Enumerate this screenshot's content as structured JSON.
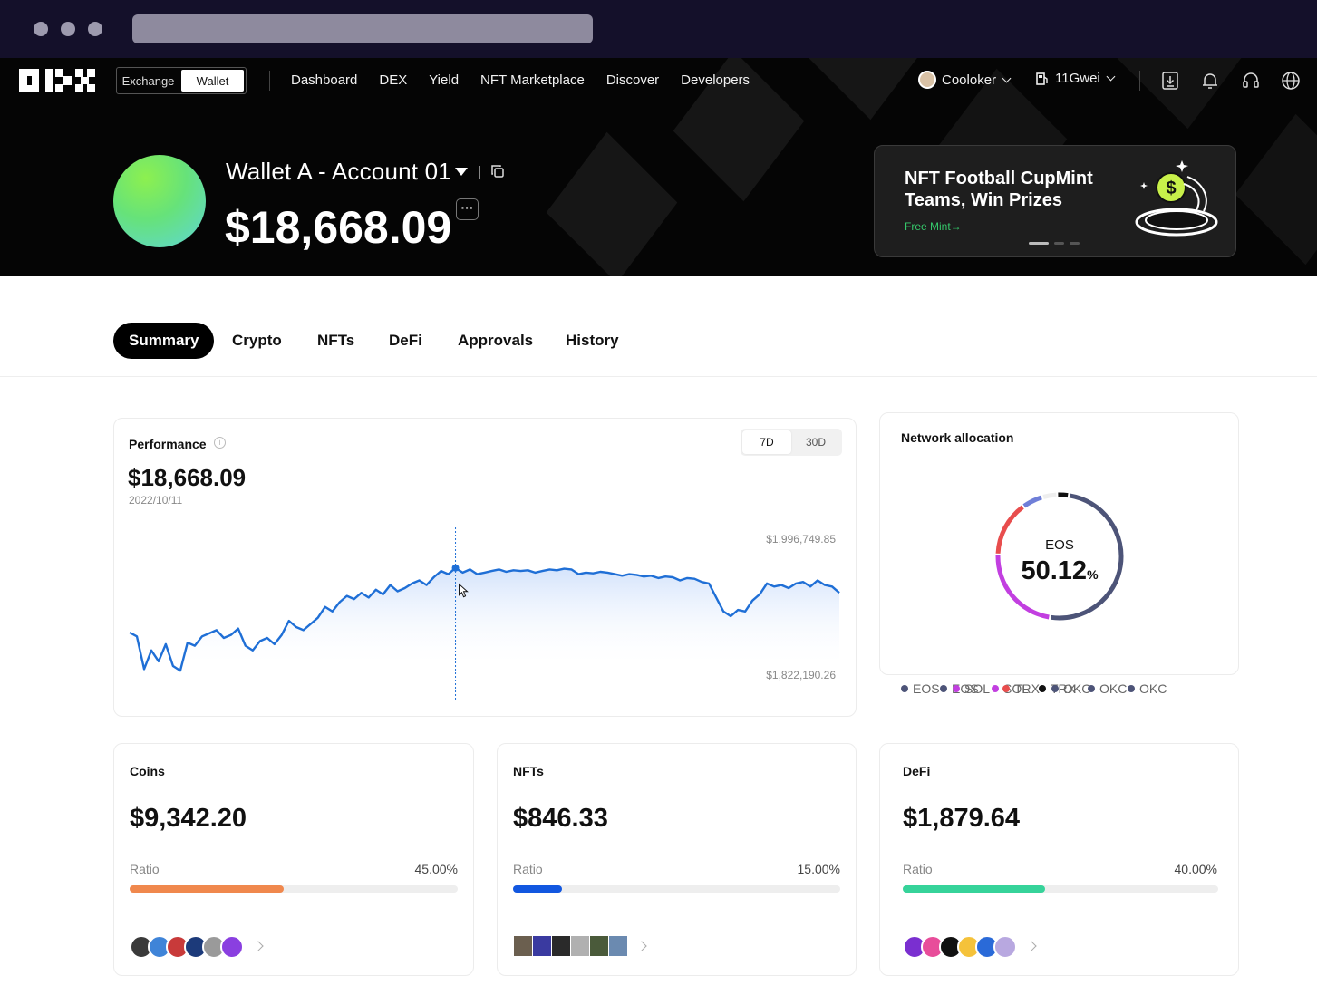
{
  "header": {
    "mode_tabs": [
      "Exchange",
      "Wallet"
    ],
    "active_mode": "Wallet",
    "nav": [
      "Dashboard",
      "DEX",
      "Yield",
      "NFT Marketplace",
      "Discover",
      "Developers"
    ],
    "username": "Cooloker",
    "gas": "11Gwei",
    "icons": [
      "download-icon",
      "bell-icon",
      "headset-icon",
      "globe-icon"
    ]
  },
  "wallet": {
    "name": "Wallet A - Account 01",
    "balance": "$18,668.09",
    "more_label": "···"
  },
  "promo": {
    "title": "NFT Football CupMint Teams, Win Prizes",
    "link": "Free Mint→",
    "slides": 3,
    "active_slide": 1
  },
  "tabs": [
    "Summary",
    "Crypto",
    "NFTs",
    "DeFi",
    "Approvals",
    "History"
  ],
  "active_tab": "Summary",
  "performance": {
    "title": "Performance",
    "value": "$18,668.09",
    "date": "2022/10/11",
    "ranges": [
      "7D",
      "30D"
    ],
    "active_range": "7D",
    "max_label": "$1,996,749.85",
    "min_label": "$1,822,190.26"
  },
  "chart_data": {
    "type": "area",
    "title": "Performance",
    "ylim": [
      1822190.26,
      1996749.85
    ],
    "color": "#1f6fd6",
    "selected_index": 45,
    "values": [
      1885000,
      1880000,
      1838000,
      1862000,
      1848000,
      1870000,
      1842000,
      1836000,
      1872000,
      1868000,
      1880000,
      1884000,
      1888000,
      1878000,
      1882000,
      1890000,
      1868000,
      1862000,
      1874000,
      1878000,
      1870000,
      1882000,
      1900000,
      1892000,
      1888000,
      1896000,
      1904000,
      1918000,
      1912000,
      1924000,
      1932000,
      1928000,
      1936000,
      1930000,
      1940000,
      1934000,
      1946000,
      1938000,
      1942000,
      1948000,
      1952000,
      1946000,
      1956000,
      1964000,
      1960000,
      1968000,
      1962000,
      1966000,
      1960000,
      1962000,
      1964000,
      1966000,
      1963000,
      1965000,
      1964000,
      1965000,
      1962000,
      1964000,
      1966000,
      1965000,
      1967000,
      1966000,
      1960000,
      1962000,
      1961000,
      1963000,
      1962000,
      1960000,
      1958000,
      1960000,
      1959000,
      1957000,
      1958000,
      1955000,
      1957000,
      1956000,
      1952000,
      1955000,
      1954000,
      1950000,
      1948000,
      1930000,
      1912000,
      1906000,
      1914000,
      1912000,
      1926000,
      1934000,
      1948000,
      1944000,
      1946000,
      1942000,
      1948000,
      1950000,
      1944000,
      1952000,
      1946000,
      1944000,
      1936000
    ]
  },
  "network_allocation": {
    "title": "Network allocation",
    "center_name": "EOS",
    "center_value": "50.12",
    "center_unit": "%",
    "segments": [
      {
        "name": "EOS",
        "value": 50.12,
        "color": "#4d5478"
      },
      {
        "name": "SOL",
        "value": 23.0,
        "color": "#c23fe0"
      },
      {
        "name": "TRX",
        "value": 14.5,
        "color": "#e84d4d"
      },
      {
        "name": "OKC",
        "value": 5.5,
        "color": "#6f7fd8"
      },
      {
        "name": "OKC",
        "value": 3.88,
        "color": "#eeeeee"
      },
      {
        "name": "OKC",
        "value": 3.0,
        "color": "#111111"
      }
    ],
    "legend": [
      {
        "name": "EOS",
        "color": "#4d5478"
      },
      {
        "name": "EOS",
        "color": "#4d5478"
      },
      {
        "name": "SOL",
        "color": "#c23fe0"
      },
      {
        "name": "SOL",
        "color": "#c23fe0"
      },
      {
        "name": "TRX",
        "color": "#e84d4d"
      },
      {
        "name": "TRX",
        "color": "#111111"
      },
      {
        "name": "OKC",
        "color": "#4d5478"
      },
      {
        "name": "OKC",
        "color": "#4d5478"
      },
      {
        "name": "OKC",
        "color": "#4d5478"
      }
    ]
  },
  "summary_cards": [
    {
      "title": "Coins",
      "value": "$9,342.20",
      "ratio_label": "Ratio",
      "ratio": "45.00%",
      "fraction": 0.47,
      "color": "#f0884d",
      "tokens": [
        "#3a3a3a",
        "#3f84d8",
        "#c83a3a",
        "#1c3a7a",
        "#9a9a9a",
        "#8a3fe0"
      ]
    },
    {
      "title": "NFTs",
      "value": "$846.33",
      "ratio_label": "Ratio",
      "ratio": "15.00%",
      "fraction": 0.15,
      "color": "#1257e0",
      "tokens": [
        "#6b5f4f",
        "#3a3aa0",
        "#2a2a2a",
        "#b0b0b0",
        "#4a5a3a",
        "#6b8ab0"
      ]
    },
    {
      "title": "DeFi",
      "value": "$1,879.64",
      "ratio_label": "Ratio",
      "ratio": "40.00%",
      "fraction": 0.45,
      "color": "#36d39a",
      "tokens": [
        "#7a2fd0",
        "#e84d9a",
        "#111111",
        "#f5c23a",
        "#2a6ad8",
        "#b8a8e0"
      ]
    }
  ]
}
